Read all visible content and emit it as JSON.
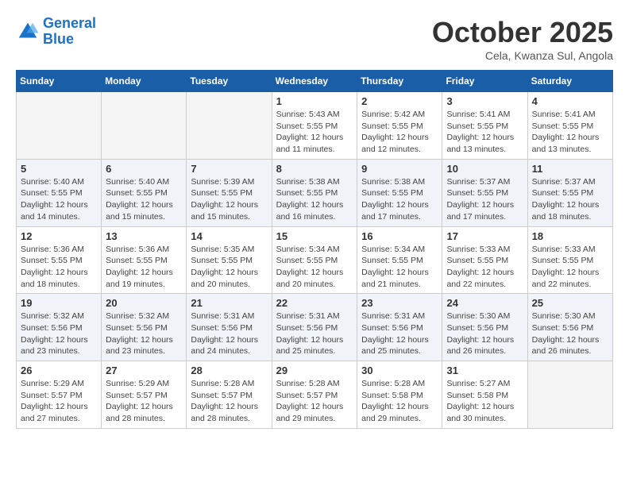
{
  "header": {
    "logo_line1": "General",
    "logo_line2": "Blue",
    "month_title": "October 2025",
    "location": "Cela, Kwanza Sul, Angola"
  },
  "weekdays": [
    "Sunday",
    "Monday",
    "Tuesday",
    "Wednesday",
    "Thursday",
    "Friday",
    "Saturday"
  ],
  "weeks": [
    [
      {
        "day": "",
        "info": ""
      },
      {
        "day": "",
        "info": ""
      },
      {
        "day": "",
        "info": ""
      },
      {
        "day": "1",
        "info": "Sunrise: 5:43 AM\nSunset: 5:55 PM\nDaylight: 12 hours\nand 11 minutes."
      },
      {
        "day": "2",
        "info": "Sunrise: 5:42 AM\nSunset: 5:55 PM\nDaylight: 12 hours\nand 12 minutes."
      },
      {
        "day": "3",
        "info": "Sunrise: 5:41 AM\nSunset: 5:55 PM\nDaylight: 12 hours\nand 13 minutes."
      },
      {
        "day": "4",
        "info": "Sunrise: 5:41 AM\nSunset: 5:55 PM\nDaylight: 12 hours\nand 13 minutes."
      }
    ],
    [
      {
        "day": "5",
        "info": "Sunrise: 5:40 AM\nSunset: 5:55 PM\nDaylight: 12 hours\nand 14 minutes."
      },
      {
        "day": "6",
        "info": "Sunrise: 5:40 AM\nSunset: 5:55 PM\nDaylight: 12 hours\nand 15 minutes."
      },
      {
        "day": "7",
        "info": "Sunrise: 5:39 AM\nSunset: 5:55 PM\nDaylight: 12 hours\nand 15 minutes."
      },
      {
        "day": "8",
        "info": "Sunrise: 5:38 AM\nSunset: 5:55 PM\nDaylight: 12 hours\nand 16 minutes."
      },
      {
        "day": "9",
        "info": "Sunrise: 5:38 AM\nSunset: 5:55 PM\nDaylight: 12 hours\nand 17 minutes."
      },
      {
        "day": "10",
        "info": "Sunrise: 5:37 AM\nSunset: 5:55 PM\nDaylight: 12 hours\nand 17 minutes."
      },
      {
        "day": "11",
        "info": "Sunrise: 5:37 AM\nSunset: 5:55 PM\nDaylight: 12 hours\nand 18 minutes."
      }
    ],
    [
      {
        "day": "12",
        "info": "Sunrise: 5:36 AM\nSunset: 5:55 PM\nDaylight: 12 hours\nand 18 minutes."
      },
      {
        "day": "13",
        "info": "Sunrise: 5:36 AM\nSunset: 5:55 PM\nDaylight: 12 hours\nand 19 minutes."
      },
      {
        "day": "14",
        "info": "Sunrise: 5:35 AM\nSunset: 5:55 PM\nDaylight: 12 hours\nand 20 minutes."
      },
      {
        "day": "15",
        "info": "Sunrise: 5:34 AM\nSunset: 5:55 PM\nDaylight: 12 hours\nand 20 minutes."
      },
      {
        "day": "16",
        "info": "Sunrise: 5:34 AM\nSunset: 5:55 PM\nDaylight: 12 hours\nand 21 minutes."
      },
      {
        "day": "17",
        "info": "Sunrise: 5:33 AM\nSunset: 5:55 PM\nDaylight: 12 hours\nand 22 minutes."
      },
      {
        "day": "18",
        "info": "Sunrise: 5:33 AM\nSunset: 5:55 PM\nDaylight: 12 hours\nand 22 minutes."
      }
    ],
    [
      {
        "day": "19",
        "info": "Sunrise: 5:32 AM\nSunset: 5:56 PM\nDaylight: 12 hours\nand 23 minutes."
      },
      {
        "day": "20",
        "info": "Sunrise: 5:32 AM\nSunset: 5:56 PM\nDaylight: 12 hours\nand 23 minutes."
      },
      {
        "day": "21",
        "info": "Sunrise: 5:31 AM\nSunset: 5:56 PM\nDaylight: 12 hours\nand 24 minutes."
      },
      {
        "day": "22",
        "info": "Sunrise: 5:31 AM\nSunset: 5:56 PM\nDaylight: 12 hours\nand 25 minutes."
      },
      {
        "day": "23",
        "info": "Sunrise: 5:31 AM\nSunset: 5:56 PM\nDaylight: 12 hours\nand 25 minutes."
      },
      {
        "day": "24",
        "info": "Sunrise: 5:30 AM\nSunset: 5:56 PM\nDaylight: 12 hours\nand 26 minutes."
      },
      {
        "day": "25",
        "info": "Sunrise: 5:30 AM\nSunset: 5:56 PM\nDaylight: 12 hours\nand 26 minutes."
      }
    ],
    [
      {
        "day": "26",
        "info": "Sunrise: 5:29 AM\nSunset: 5:57 PM\nDaylight: 12 hours\nand 27 minutes."
      },
      {
        "day": "27",
        "info": "Sunrise: 5:29 AM\nSunset: 5:57 PM\nDaylight: 12 hours\nand 28 minutes."
      },
      {
        "day": "28",
        "info": "Sunrise: 5:28 AM\nSunset: 5:57 PM\nDaylight: 12 hours\nand 28 minutes."
      },
      {
        "day": "29",
        "info": "Sunrise: 5:28 AM\nSunset: 5:57 PM\nDaylight: 12 hours\nand 29 minutes."
      },
      {
        "day": "30",
        "info": "Sunrise: 5:28 AM\nSunset: 5:58 PM\nDaylight: 12 hours\nand 29 minutes."
      },
      {
        "day": "31",
        "info": "Sunrise: 5:27 AM\nSunset: 5:58 PM\nDaylight: 12 hours\nand 30 minutes."
      },
      {
        "day": "",
        "info": ""
      }
    ]
  ]
}
